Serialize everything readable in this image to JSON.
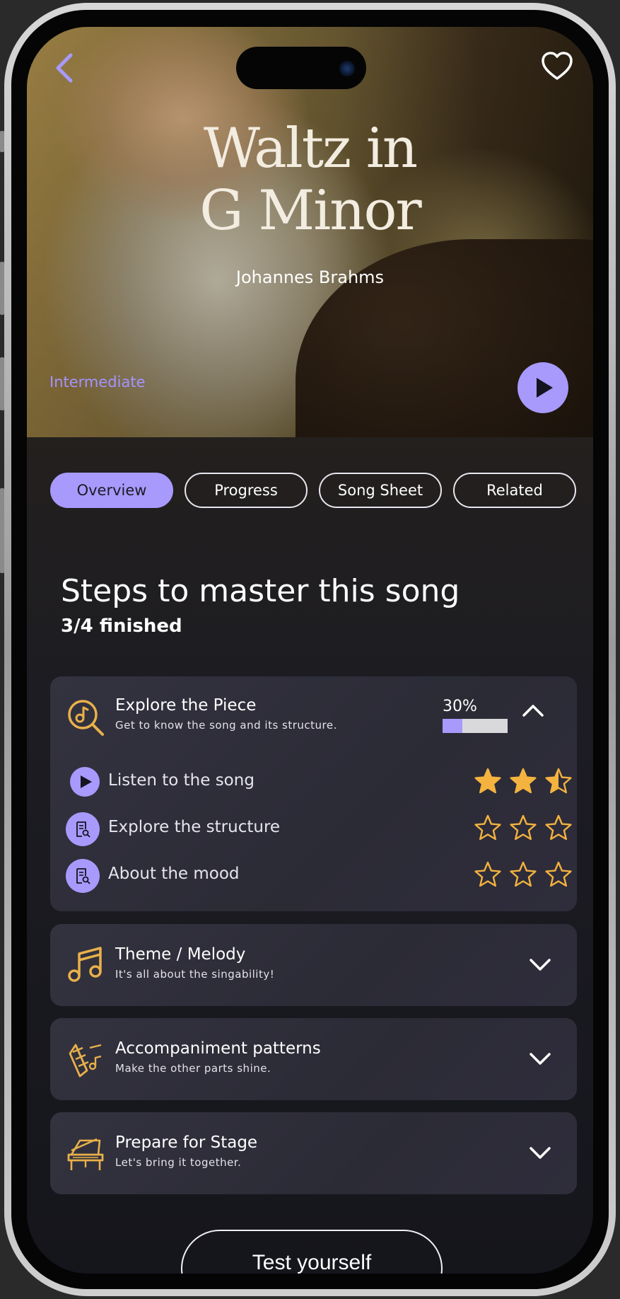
{
  "song": {
    "title_line1": "Waltz in",
    "title_line2": "G Minor",
    "composer": "Johannes Brahms",
    "level": "Intermediate"
  },
  "icons": {
    "back": "chevron-left-icon",
    "favorite": "heart-icon",
    "play": "play-icon"
  },
  "tabs": [
    {
      "label": "Overview",
      "active": true
    },
    {
      "label": "Progress",
      "active": false
    },
    {
      "label": "Song Sheet",
      "active": false
    },
    {
      "label": "Related",
      "active": false
    }
  ],
  "steps_section": {
    "title": "Steps to master this song",
    "subtitle": "3/4 finished"
  },
  "cards": [
    {
      "title": "Explore the Piece",
      "description": "Get to know the song and its structure.",
      "icon": "music-search-icon",
      "progress_label": "30%",
      "progress": 0.3,
      "expanded": true,
      "steps": [
        {
          "label": "Listen to the song",
          "icon": "play-icon",
          "stars": 2.5
        },
        {
          "label": "Explore the structure",
          "icon": "document-search-icon",
          "stars": 0
        },
        {
          "label": "About the mood",
          "icon": "document-search-icon",
          "stars": 0
        }
      ]
    },
    {
      "title": "Theme / Melody",
      "description": "It's all about the singability!",
      "icon": "music-notes-icon",
      "expanded": false
    },
    {
      "title": "Accompaniment patterns",
      "description": "Make the other parts shine.",
      "icon": "accompaniment-icon",
      "expanded": false
    },
    {
      "title": "Prepare for Stage",
      "description": "Let's bring it together.",
      "icon": "piano-icon",
      "expanded": false
    }
  ],
  "test_button": {
    "label": "Test yourself"
  },
  "colors": {
    "accent": "#a79afc",
    "star": "#f4b23f",
    "icon_gold": "#e9b14a"
  }
}
